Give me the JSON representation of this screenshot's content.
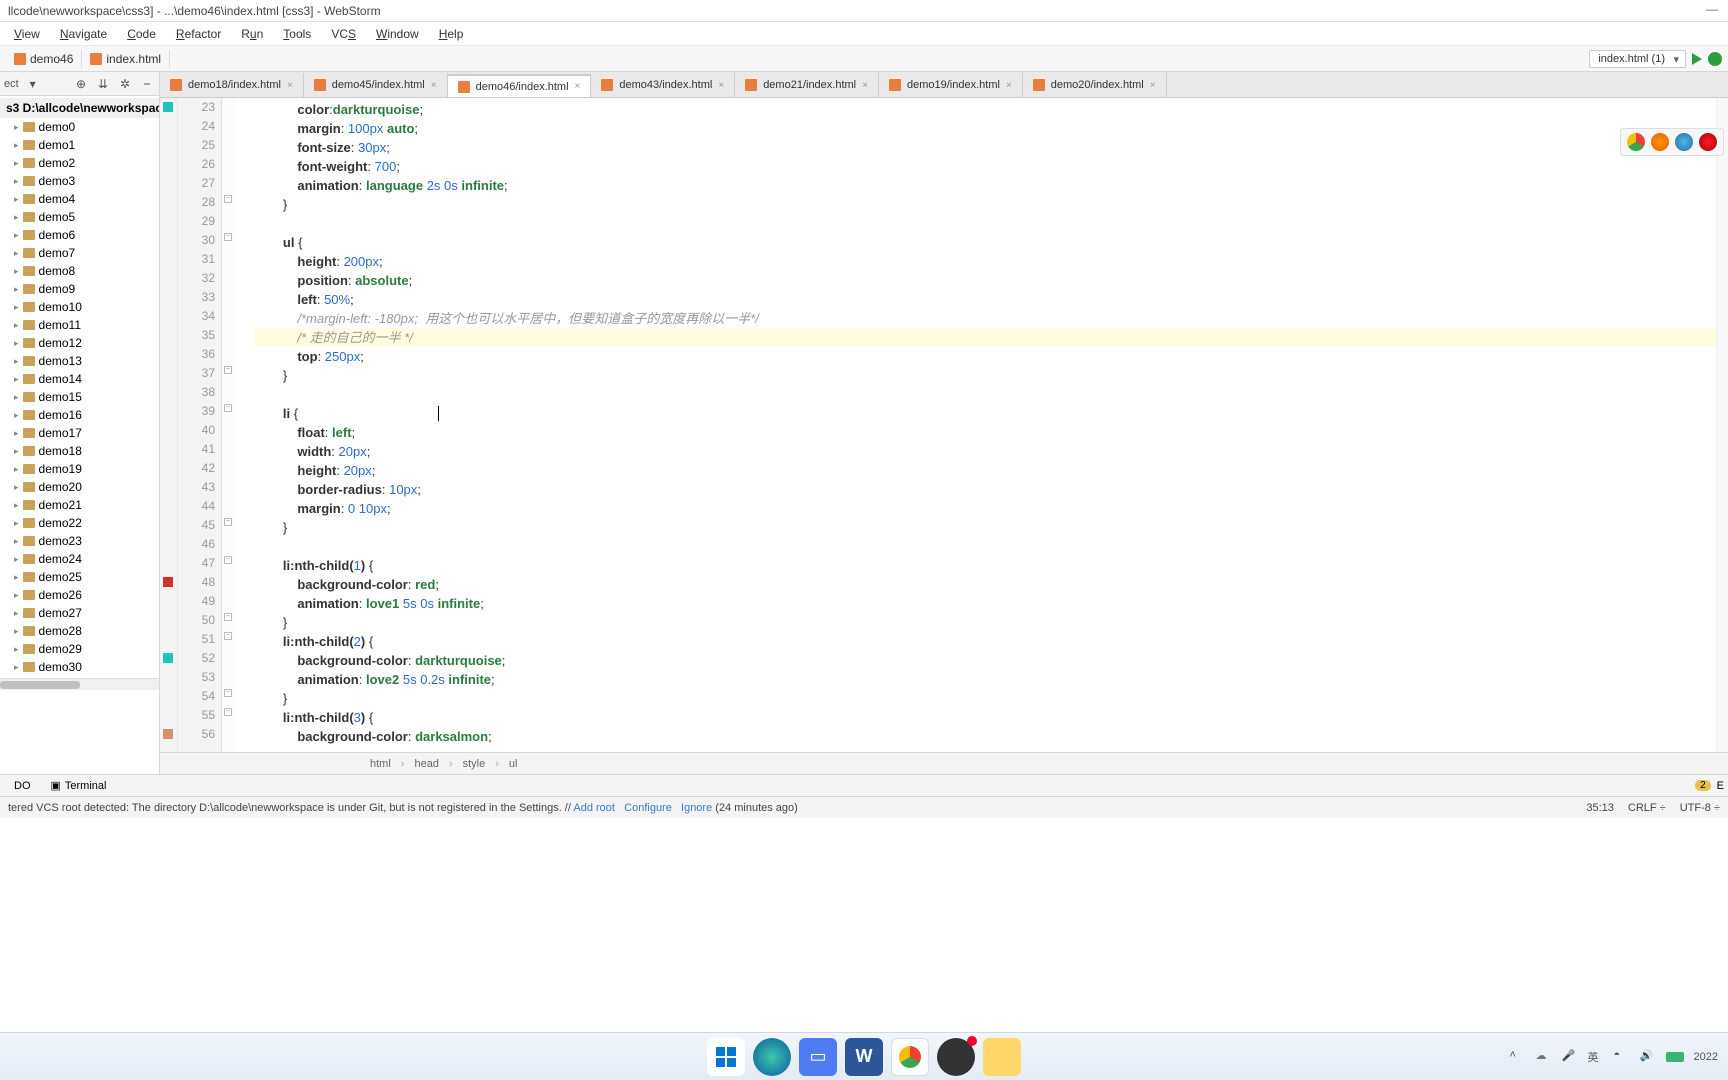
{
  "titlebar": {
    "text": "llcode\\newworkspace\\css3] - ...\\demo46\\index.html [css3] - WebStorm"
  },
  "menubar": {
    "items": [
      "View",
      "Navigate",
      "Code",
      "Refactor",
      "Run",
      "Tools",
      "VCS",
      "Window",
      "Help"
    ],
    "underlines": [
      "V",
      "N",
      "C",
      "R",
      "u",
      "T",
      "S",
      "W",
      "H"
    ]
  },
  "navbar": {
    "crumb1": "demo46",
    "crumb2": "index.html",
    "run_config": "index.html (1)"
  },
  "sidebar": {
    "toolbar_label": "ect",
    "root": "s3  D:\\allcode\\newworkspace",
    "items": [
      "demo0",
      "demo1",
      "demo2",
      "demo3",
      "demo4",
      "demo5",
      "demo6",
      "demo7",
      "demo8",
      "demo9",
      "demo10",
      "demo11",
      "demo12",
      "demo13",
      "demo14",
      "demo15",
      "demo16",
      "demo17",
      "demo18",
      "demo19",
      "demo20",
      "demo21",
      "demo22",
      "demo23",
      "demo24",
      "demo25",
      "demo26",
      "demo27",
      "demo28",
      "demo29",
      "demo30"
    ]
  },
  "tabs": {
    "items": [
      {
        "label": "demo18/index.html",
        "active": false
      },
      {
        "label": "demo45/index.html",
        "active": false
      },
      {
        "label": "demo46/index.html",
        "active": true
      },
      {
        "label": "demo43/index.html",
        "active": false
      },
      {
        "label": "demo21/index.html",
        "active": false
      },
      {
        "label": "demo19/index.html",
        "active": false
      },
      {
        "label": "demo20/index.html",
        "active": false
      }
    ]
  },
  "code": {
    "first_line": 23,
    "current_line": 35,
    "caret_line_idx": 12,
    "lines": [
      {
        "n": 23,
        "html": "            <span class='prop'>color</span>:<span class='val'>darkturquoise</span>;"
      },
      {
        "n": 24,
        "html": "            <span class='prop'>margin</span>: <span class='num'>100px</span> <span class='val'>auto</span>;"
      },
      {
        "n": 25,
        "html": "            <span class='prop'>font-size</span>: <span class='num'>30px</span>;"
      },
      {
        "n": 26,
        "html": "            <span class='prop'>font-weight</span>: <span class='num'>700</span>;"
      },
      {
        "n": 27,
        "html": "            <span class='prop'>animation</span>: <span class='val'>language</span> <span class='num'>2s</span> <span class='num'>0s</span> <span class='val'>infinite</span>;"
      },
      {
        "n": 28,
        "html": "        }"
      },
      {
        "n": 29,
        "html": ""
      },
      {
        "n": 30,
        "html": "        <span class='sel'>ul</span> {"
      },
      {
        "n": 31,
        "html": "            <span class='prop'>height</span>: <span class='num'>200px</span>;"
      },
      {
        "n": 32,
        "html": "            <span class='prop'>position</span>: <span class='val'>absolute</span>;"
      },
      {
        "n": 33,
        "html": "            <span class='prop'>left</span>: <span class='num'>50%</span>;"
      },
      {
        "n": 34,
        "html": "            <span class='cm'>/*margin-left: -180px;  用这个也可以水平居中，但要知道盒子的宽度再除以一半*/</span>"
      },
      {
        "n": 35,
        "html": "            <span class='caret-mark' style='position:relative;'></span><span class='cm'>/* 走的自己的一半 */</span>",
        "hl": true
      },
      {
        "n": 36,
        "html": "            <span class='prop'>top</span>: <span class='num'>250px</span>;"
      },
      {
        "n": 37,
        "html": "        }"
      },
      {
        "n": 38,
        "html": ""
      },
      {
        "n": 39,
        "html": "        <span class='sel'>li</span> {"
      },
      {
        "n": 40,
        "html": "            <span class='prop'>float</span>: <span class='val'>left</span>;"
      },
      {
        "n": 41,
        "html": "            <span class='prop'>width</span>: <span class='num'>20px</span>;"
      },
      {
        "n": 42,
        "html": "            <span class='prop'>height</span>: <span class='num'>20px</span>;"
      },
      {
        "n": 43,
        "html": "            <span class='prop'>border-radius</span>: <span class='num'>10px</span>;"
      },
      {
        "n": 44,
        "html": "            <span class='prop'>margin</span>: <span class='num'>0</span> <span class='num'>10px</span>;"
      },
      {
        "n": 45,
        "html": "        }"
      },
      {
        "n": 46,
        "html": ""
      },
      {
        "n": 47,
        "html": "        <span class='sel'>li:nth-child(</span><span class='num'>1</span><span class='sel'>)</span> {"
      },
      {
        "n": 48,
        "html": "            <span class='prop'>background-color</span>: <span class='val'>red</span>;"
      },
      {
        "n": 49,
        "html": "            <span class='prop'>animation</span>: <span class='val'>love1</span> <span class='num'>5s</span> <span class='num'>0s</span> <span class='val'>infinite</span>;"
      },
      {
        "n": 50,
        "html": "        }"
      },
      {
        "n": 51,
        "html": "        <span class='sel'>li:nth-child(</span><span class='num'>2</span><span class='sel'>)</span> {"
      },
      {
        "n": 52,
        "html": "            <span class='prop'>background-color</span>: <span class='val'>darkturquoise</span>;"
      },
      {
        "n": 53,
        "html": "            <span class='prop'>animation</span>: <span class='val'>love2</span> <span class='num'>5s</span> <span class='num'>0.2s</span> <span class='val'>infinite</span>;"
      },
      {
        "n": 54,
        "html": "        }"
      },
      {
        "n": 55,
        "html": "        <span class='sel'>li:nth-child(</span><span class='num'>3</span><span class='sel'>)</span> {"
      },
      {
        "n": 56,
        "html": "            <span class='prop'>background-color</span>: <span class='val'>darksalmon</span>;"
      }
    ],
    "gutter_marks": [
      {
        "line": 23,
        "color": "#1fc5b8"
      },
      {
        "line": 48,
        "color": "#d62c2c"
      },
      {
        "line": 52,
        "color": "#1fc5b8"
      },
      {
        "line": 56,
        "color": "#d98e6d"
      }
    ]
  },
  "code_breadcrumb": {
    "items": [
      "html",
      "head",
      "style",
      "ul"
    ]
  },
  "bottom_tabs": {
    "left": [
      {
        "label": "DO"
      },
      {
        "label": "Terminal",
        "icon": "▣"
      }
    ],
    "right_badge": "2",
    "right_label": "E"
  },
  "statusbar": {
    "message_prefix": "tered VCS root detected: The directory D:\\allcode\\newworkspace is under Git, but is not registered in the Settings.  // ",
    "link1": "Add root",
    "link2": "Configure",
    "link3": "Ignore",
    "age": " (24 minutes ago)",
    "pos": "35:13",
    "sep": "CRLF ÷",
    "enc": "UTF-8 ÷"
  },
  "taskbar": {
    "time": "2022"
  }
}
